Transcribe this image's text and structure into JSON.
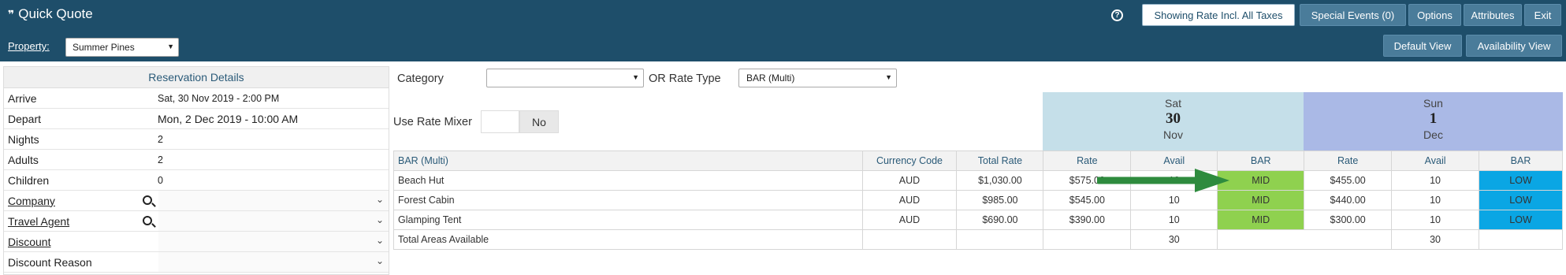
{
  "header": {
    "title": "Quick Quote",
    "help": "?",
    "buttons": {
      "rate_toggle": "Showing Rate Incl. All Taxes",
      "special_events": "Special Events (0)",
      "options": "Options",
      "attributes": "Attributes",
      "exit": "Exit",
      "default_view": "Default View",
      "availability_view": "Availability View"
    },
    "property_label": "Property:",
    "property_value": "Summer Pines"
  },
  "reservation": {
    "title": "Reservation Details",
    "arrive_label": "Arrive",
    "arrive_value": "Sat, 30 Nov 2019 - 2:00 PM",
    "depart_label": "Depart",
    "depart_value": "Mon, 2 Dec 2019 - 10:00 AM",
    "nights_label": "Nights",
    "nights_value": "2",
    "adults_label": "Adults",
    "adults_value": "2",
    "children_label": "Children",
    "children_value": "0",
    "company_label": "Company",
    "agent_label": "Travel Agent",
    "discount_label": "Discount",
    "reason_label": "Discount Reason"
  },
  "filters": {
    "category_label": "Category",
    "category_value": "",
    "or_label": "OR Rate Type",
    "rate_type_value": "BAR (Multi)",
    "mixer_label": "Use Rate Mixer",
    "mixer_value": "No"
  },
  "days": [
    {
      "name": "Sat",
      "num": "30",
      "month": "Nov"
    },
    {
      "name": "Sun",
      "num": "1",
      "month": "Dec"
    }
  ],
  "grid": {
    "headers": [
      "BAR (Multi)",
      "Currency Code",
      "Total Rate",
      "Rate",
      "Avail",
      "BAR",
      "Rate",
      "Avail",
      "BAR"
    ],
    "rows": [
      {
        "name": "Beach Hut",
        "currency": "AUD",
        "total": "$1,030.00",
        "rate1": "$575.00",
        "avail1": "10",
        "bar1": "MID",
        "rate2": "$455.00",
        "avail2": "10",
        "bar2": "LOW"
      },
      {
        "name": "Forest Cabin",
        "currency": "AUD",
        "total": "$985.00",
        "rate1": "$545.00",
        "avail1": "10",
        "bar1": "MID",
        "rate2": "$440.00",
        "avail2": "10",
        "bar2": "LOW"
      },
      {
        "name": "Glamping Tent",
        "currency": "AUD",
        "total": "$690.00",
        "rate1": "$390.00",
        "avail1": "10",
        "bar1": "MID",
        "rate2": "$300.00",
        "avail2": "10",
        "bar2": "LOW"
      }
    ],
    "total_label": "Total Areas Available",
    "total_avail1": "30",
    "total_avail2": "30"
  },
  "colors": {
    "header_bg": "#1e4e6a",
    "button_bg": "#4a7c9a",
    "mid": "#8fd14f",
    "low": "#0aa6e4",
    "sat_bg": "#c5dfe9",
    "sun_bg": "#aab9e6",
    "arrow": "#2e8b3e"
  }
}
